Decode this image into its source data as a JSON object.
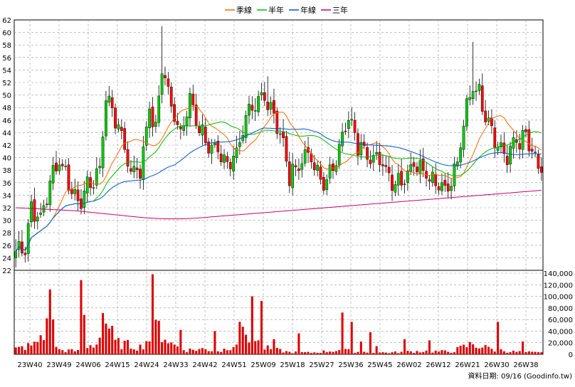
{
  "legend": {
    "quarter": "季線",
    "half_year": "半年",
    "year": "年線",
    "three_year": "三年"
  },
  "source_label": "資料日期: 09/16  (Goodinfo.tw)",
  "chart_data": {
    "type": "candlestick",
    "price_axis": {
      "min": 22,
      "max": 62,
      "ticks": [
        22,
        24,
        26,
        28,
        30,
        32,
        34,
        36,
        38,
        40,
        42,
        44,
        46,
        48,
        50,
        52,
        54,
        56,
        58,
        60,
        62
      ]
    },
    "volume_axis": {
      "min": 0,
      "max": 140000,
      "ticks": [
        0,
        20000,
        40000,
        60000,
        80000,
        100000,
        120000,
        140000
      ],
      "tick_labels": [
        "0",
        "20,000",
        "40,000",
        "60,000",
        "80,000",
        "100,000",
        "120,000",
        "140,000"
      ]
    },
    "x_labels": [
      "23W40",
      "23W49",
      "24W06",
      "24W15",
      "24W24",
      "24W33",
      "24W42",
      "24W51",
      "25W09",
      "25W18",
      "25W27",
      "25W36",
      "25W45",
      "26W02",
      "26W12",
      "26W21",
      "26W30",
      "26W38"
    ],
    "grid": true,
    "colors": {
      "up": "#00cc00",
      "down": "#ff0000",
      "quarter": "#ff6600",
      "half_year": "#00bb00",
      "year": "#0055cc",
      "three_year": "#cc0066",
      "volume": "#dd0000"
    },
    "price_key_points": [
      [
        0,
        25
      ],
      [
        3,
        26
      ],
      [
        5,
        32
      ],
      [
        8,
        30
      ],
      [
        11,
        36
      ],
      [
        14,
        40
      ],
      [
        17,
        36
      ],
      [
        20,
        33
      ],
      [
        23,
        35
      ],
      [
        27,
        38
      ],
      [
        29,
        50
      ],
      [
        33,
        45
      ],
      [
        37,
        38
      ],
      [
        40,
        38
      ],
      [
        43,
        48
      ],
      [
        45,
        44
      ],
      [
        47,
        55
      ],
      [
        50,
        48
      ],
      [
        53,
        44
      ],
      [
        56,
        50
      ],
      [
        59,
        44
      ],
      [
        62,
        42
      ],
      [
        65,
        41
      ],
      [
        68,
        39
      ],
      [
        71,
        41
      ],
      [
        74,
        46
      ],
      [
        77,
        48
      ],
      [
        80,
        50
      ],
      [
        83,
        47
      ],
      [
        85,
        44
      ],
      [
        88,
        37
      ],
      [
        91,
        39
      ],
      [
        94,
        41
      ],
      [
        97,
        37
      ],
      [
        99,
        36
      ],
      [
        102,
        38
      ],
      [
        105,
        44
      ],
      [
        107,
        46
      ],
      [
        110,
        42
      ],
      [
        113,
        41
      ],
      [
        116,
        40
      ],
      [
        119,
        38
      ],
      [
        122,
        36
      ],
      [
        125,
        37
      ],
      [
        128,
        39
      ],
      [
        130,
        39
      ],
      [
        133,
        37
      ],
      [
        136,
        36
      ],
      [
        139,
        35
      ],
      [
        142,
        39
      ],
      [
        145,
        48
      ],
      [
        147,
        52
      ],
      [
        149,
        50
      ],
      [
        152,
        46
      ],
      [
        155,
        42
      ],
      [
        158,
        40
      ],
      [
        161,
        43
      ],
      [
        164,
        43
      ],
      [
        166,
        41
      ],
      [
        168,
        38
      ]
    ],
    "volume_key_points": [
      [
        0,
        10000
      ],
      [
        6,
        18000
      ],
      [
        10,
        50000
      ],
      [
        14,
        8000
      ],
      [
        20,
        6000
      ],
      [
        26,
        20000
      ],
      [
        28,
        80000
      ],
      [
        32,
        22000
      ],
      [
        40,
        14000
      ],
      [
        46,
        50000
      ],
      [
        50,
        20000
      ],
      [
        55,
        8000
      ],
      [
        60,
        10000
      ],
      [
        66,
        6000
      ],
      [
        70,
        20000
      ],
      [
        74,
        40000
      ],
      [
        80,
        12000
      ],
      [
        88,
        4000
      ],
      [
        95,
        3000
      ],
      [
        104,
        8000
      ],
      [
        110,
        5000
      ],
      [
        120,
        3000
      ],
      [
        130,
        6000
      ],
      [
        140,
        5000
      ],
      [
        147,
        20000
      ],
      [
        152,
        10000
      ],
      [
        160,
        5000
      ],
      [
        168,
        3000
      ]
    ],
    "volume_spikes": [
      [
        11,
        112000
      ],
      [
        12,
        60000
      ],
      [
        21,
        128000
      ],
      [
        22,
        68000
      ],
      [
        44,
        138000
      ],
      [
        53,
        42000
      ],
      [
        64,
        40000
      ],
      [
        72,
        56000
      ],
      [
        76,
        100000
      ],
      [
        79,
        92000
      ],
      [
        83,
        26000
      ],
      [
        91,
        36000
      ],
      [
        105,
        72000
      ],
      [
        108,
        56000
      ],
      [
        111,
        22000
      ],
      [
        114,
        38000
      ],
      [
        116,
        14000
      ],
      [
        125,
        26000
      ],
      [
        133,
        24000
      ],
      [
        151,
        16000
      ],
      [
        155,
        56000
      ],
      [
        163,
        22000
      ]
    ],
    "price_spikes": [
      [
        47,
        61
      ],
      [
        81,
        53
      ],
      [
        147,
        58.5
      ]
    ]
  }
}
